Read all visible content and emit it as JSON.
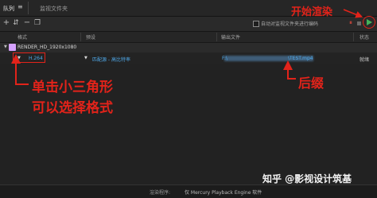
{
  "tabs": {
    "queue": "队列",
    "menu": "≡",
    "watch_folder": "监视文件夹"
  },
  "toolbar": {
    "auto_encode_label": "自动对监视文件夹进行编码"
  },
  "columns": {
    "format": "格式",
    "preset": "预设",
    "output": "输出文件",
    "status": "状态"
  },
  "queue_item": {
    "name": "RENDER_HD_1920x1080",
    "format": "H.264",
    "preset": "匹配源 - 高比特率",
    "output_prefix": "F:\\",
    "output_suffix": "\\TEST.mp4",
    "status": "就绪"
  },
  "statusbar": {
    "renderer_label": "渲染程序:",
    "renderer_value": "仅 Mercury Playback Engine 软件"
  },
  "annotations": {
    "start_render": "开始渲染",
    "click_triangle_line1": "单击小三角形",
    "click_triangle_line2": "可以选择格式",
    "suffix": "后缀"
  },
  "watermark": "知乎 @影视设计筑基",
  "colors": {
    "annotation_red": "#e2231a",
    "link_blue": "#4fa8e8",
    "play_green": "#44b35a"
  }
}
